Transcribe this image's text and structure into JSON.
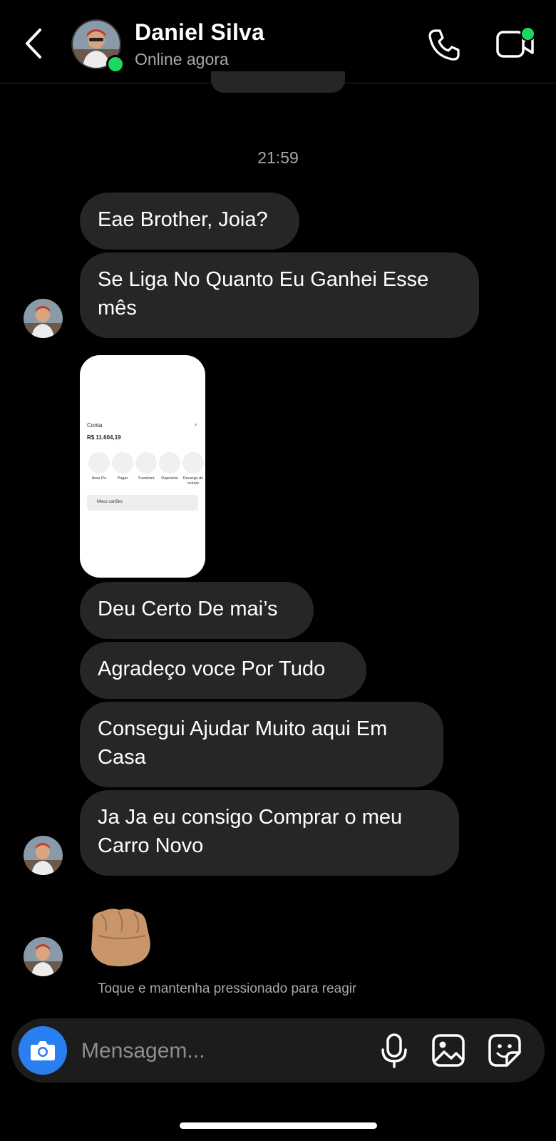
{
  "header": {
    "contact_name": "Daniel Silva",
    "status": "Online agora",
    "online_color": "#1ed760",
    "icons": [
      "back-icon",
      "phone-icon",
      "video-call-icon"
    ]
  },
  "thread": {
    "timestamp": "21:59",
    "messages": [
      "Eae Brother, Joia?",
      "Se Liga No Quanto Eu Ganhei Esse mês",
      "Deu Certo De mai’s",
      "Agradeço voce Por Tudo",
      "Consegui Ajudar Muito aqui Em Casa",
      "Ja Ja eu consigo Comprar o meu Carro Novo"
    ],
    "shared_image": {
      "conta_label": "Conta",
      "balance": "R$ 11.604,19",
      "actions": [
        "Área Pix",
        "Pagar",
        "Transferir",
        "Depositar",
        "Recarga de celular"
      ],
      "cards_label": "Meus cartões"
    },
    "reaction_emoji": "fist-emoji",
    "react_hint": "Toque e mantenha pressionado para reagir"
  },
  "composer": {
    "placeholder": "Mensagem...",
    "camera_color": "#2a7ff0",
    "icons": [
      "camera-icon",
      "microphone-icon",
      "gallery-icon",
      "sticker-icon"
    ]
  }
}
